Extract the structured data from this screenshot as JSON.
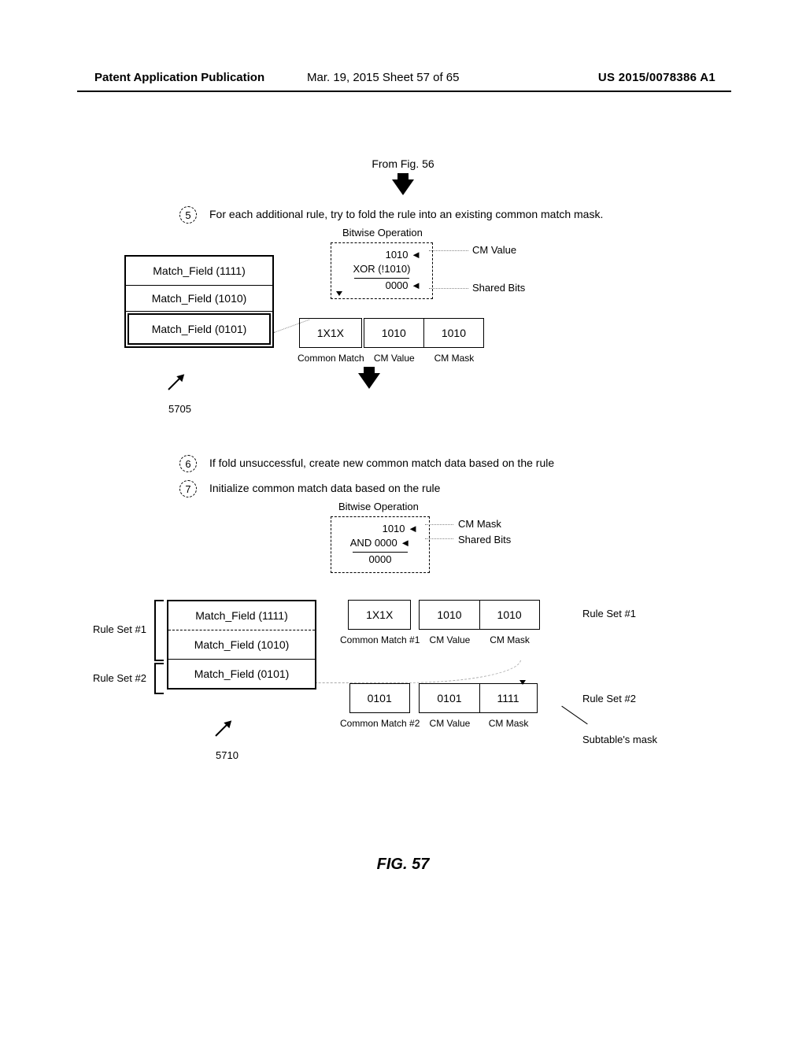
{
  "header": {
    "left": "Patent Application Publication",
    "mid": "Mar. 19, 2015  Sheet 57 of 65",
    "right": "US 2015/0078386 A1"
  },
  "from_fig": "From Fig. 56",
  "steps": {
    "s5": {
      "num": "5",
      "text": "For each additional rule, try to fold the rule into an existing common match mask."
    },
    "s6": {
      "num": "6",
      "text": "If fold unsuccessful, create new common match data based on the rule"
    },
    "s7": {
      "num": "7",
      "text": "Initialize common match data based on the rule"
    }
  },
  "section5": {
    "bitop_label": "Bitwise Operation",
    "bitbox": {
      "l1": "1010 ◄",
      "l2": "XOR (!1010)",
      "l3": "0000 ◄"
    },
    "cm_value_label": "CM Value",
    "shared_bits_label": "Shared Bits",
    "matchfields": [
      "Match_Field (1111)",
      "Match_Field (1010)",
      "Match_Field (0101)"
    ],
    "triple": {
      "cm": "1X1X",
      "val": "1010",
      "mask": "1010"
    },
    "triple_labels": {
      "cm": "Common Match",
      "val": "CM Value",
      "mask": "CM Mask"
    },
    "ref": "5705"
  },
  "section67": {
    "bitop_label": "Bitwise Operation",
    "bitbox": {
      "l1": "1010 ◄",
      "l2": "AND 0000 ◄",
      "l3": "0000"
    },
    "cm_mask_label": "CM Mask",
    "shared_bits_label": "Shared Bits",
    "left": {
      "rs1": "Rule Set #1",
      "rs2": "Rule Set #2",
      "rows": [
        "Match_Field (1111)",
        "Match_Field (1010)",
        "Match_Field (0101)"
      ]
    },
    "t1": {
      "cm": "1X1X",
      "val": "1010",
      "mask": "1010",
      "rs": "Rule Set #1"
    },
    "t1_labels": {
      "cm": "Common Match #1",
      "val": "CM Value",
      "mask": "CM Mask"
    },
    "t2": {
      "cm": "0101",
      "val": "0101",
      "mask": "1111",
      "rs": "Rule Set #2"
    },
    "t2_labels": {
      "cm": "Common Match #2",
      "val": "CM Value",
      "mask": "CM Mask"
    },
    "subtable": "Subtable's mask",
    "ref": "5710"
  },
  "caption": "FIG. 57"
}
